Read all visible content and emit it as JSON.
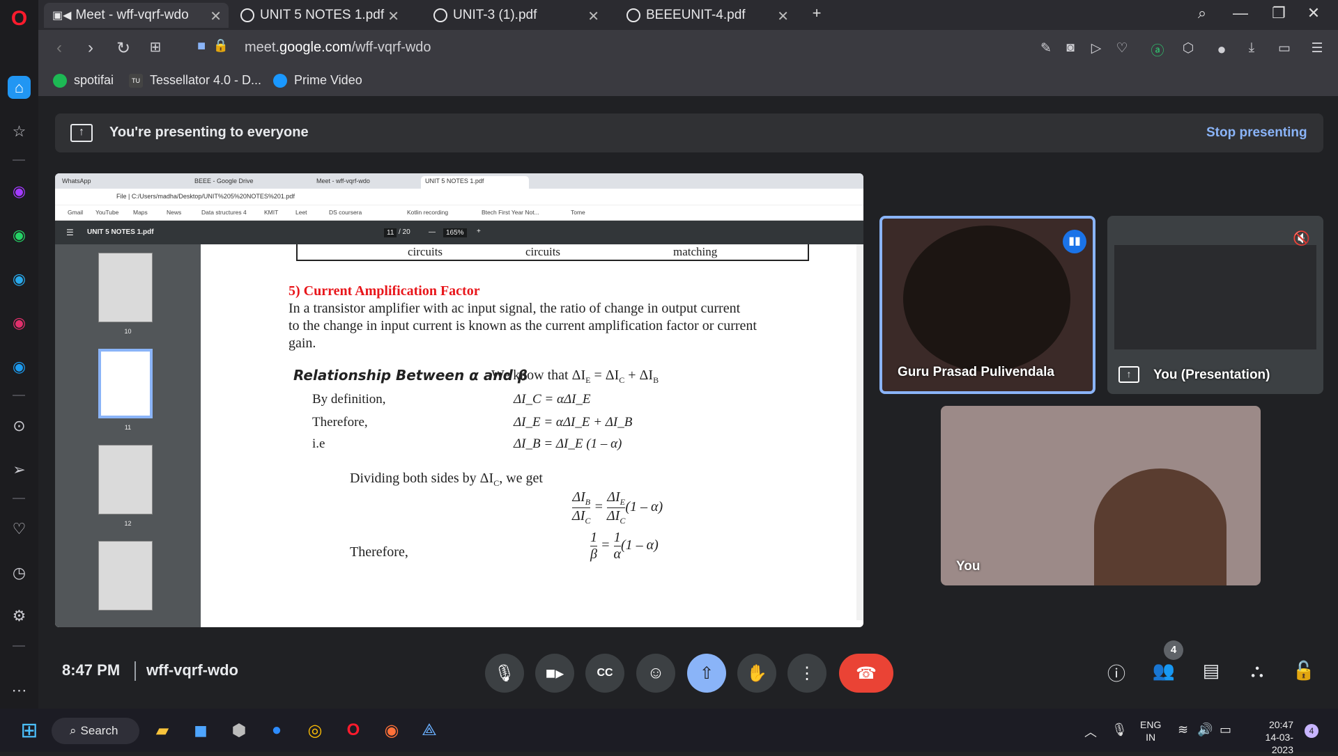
{
  "browser": {
    "tabs": [
      {
        "title": "Meet - wff-vqrf-wdo",
        "active": true
      },
      {
        "title": "UNIT 5 NOTES 1.pdf",
        "active": false
      },
      {
        "title": "UNIT-3 (1).pdf",
        "active": false
      },
      {
        "title": "BEEEUNIT-4.pdf",
        "active": false
      }
    ],
    "url_prefix": "meet.",
    "url_domain": "google.com",
    "url_path": "/wff-vqrf-wdo",
    "bookmarks": [
      "spotifai",
      "Tessellator 4.0 - D...",
      "Prime Video"
    ],
    "tessellator_badge": "TU"
  },
  "meet": {
    "presenting_text": "You're presenting to everyone",
    "stop_presenting": "Stop presenting",
    "time": "8:47 PM",
    "meeting_code": "wff-vqrf-wdo",
    "participant_count": "4",
    "tiles": [
      {
        "name": "Guru Prasad Pulivendala",
        "speaking": true
      },
      {
        "name": "You (Presentation)",
        "muted": true
      },
      {
        "name": "You"
      }
    ]
  },
  "shared_screen": {
    "tabs": [
      "WhatsApp",
      "BEEE - Google Drive",
      "Meet - wff-vqrf-wdo",
      "UNIT 5 NOTES 1.pdf"
    ],
    "address": "File  |  C:/Users/madha/Desktop/UNIT%205%20NOTES%201.pdf",
    "bookmarks": [
      "Gmail",
      "YouTube",
      "Maps",
      "News",
      "Data structures 4",
      "KMIT",
      "Leet",
      "DS coursera",
      "Kotlin recording",
      "Btech First Year Not...",
      "Tome"
    ],
    "pdf_title": "UNIT 5 NOTES 1.pdf",
    "page_current": "11",
    "page_total": "/ 20",
    "zoom": "165%",
    "thumbnail_pages": [
      "10",
      "11",
      "12"
    ],
    "page": {
      "table_row": [
        "circuits",
        "circuits",
        "matching"
      ],
      "section_heading": "5) Current Amplification Factor",
      "para_line1": "In a transistor amplifier with ac input signal, the ratio of change in output current",
      "para_line2": "to the change in input current is known as the current amplification factor or current",
      "para_line3": "gain.",
      "rel_heading": "Relationship Between α and β",
      "we_know": "We know that ΔI",
      "eq_rows": [
        {
          "label": "By definition,",
          "eq": "ΔI_C = αΔI_E"
        },
        {
          "label": "Therefore,",
          "eq": "ΔI_E = αΔI_E + ΔI_B"
        },
        {
          "label": "i.e",
          "eq": "ΔI_B = ΔI_E (1 – α)"
        }
      ],
      "dividing": "Dividing both sides by ΔI",
      "we_get": ", we get",
      "therefore2": "Therefore,"
    }
  },
  "taskbar": {
    "search": "Search",
    "lang1": "ENG",
    "lang2": "IN",
    "clock_time": "20:47",
    "clock_date": "14-03-2023",
    "notif": "4"
  },
  "colors": {
    "accent_blue": "#8ab4f8",
    "end_call_red": "#ea4335",
    "present_active": "#8ab4f8",
    "pdf_heading_red": "#e8161b"
  }
}
